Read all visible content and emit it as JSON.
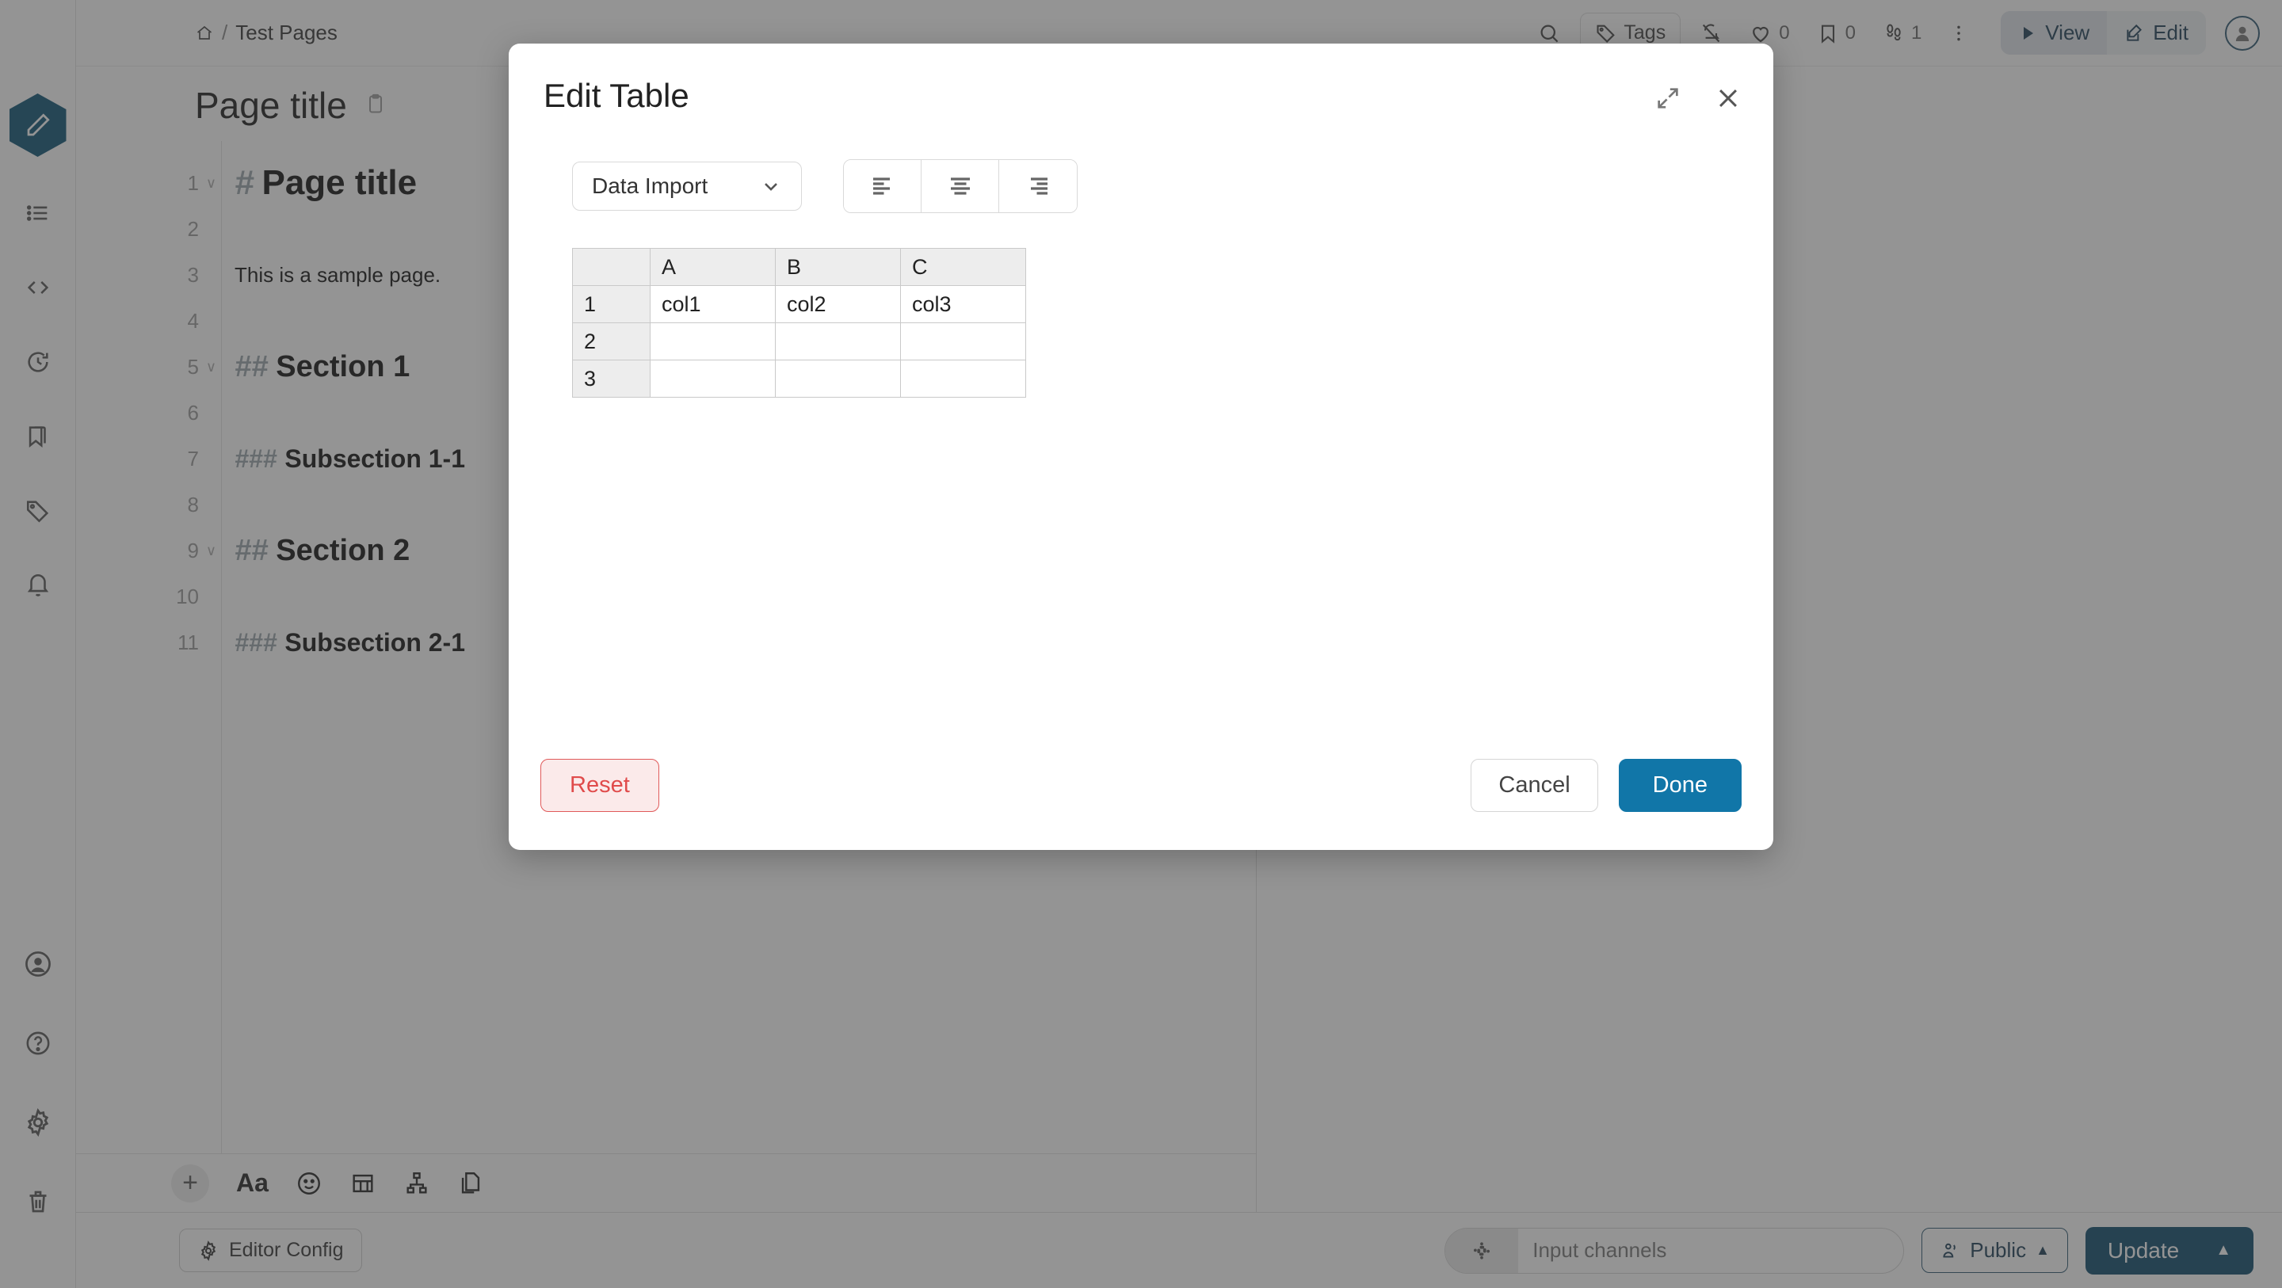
{
  "breadcrumb": {
    "home_icon": "home-icon",
    "separator": "/",
    "path": "Test Pages"
  },
  "header": {
    "search_icon": "search-icon",
    "tags_label": "Tags",
    "tags_icon": "tag-icon",
    "bell_off_icon": "bell-off-icon",
    "heart_icon": "heart-icon",
    "heart_count": "0",
    "bookmark_icon": "bookmark-icon",
    "bookmark_count": "0",
    "footprints_icon": "footprints-icon",
    "footprints_count": "1",
    "kebab_icon": "more-vertical-icon",
    "view_label": "View",
    "view_icon": "play-icon",
    "edit_label": "Edit",
    "edit_icon": "pencil-square-icon",
    "avatar_icon": "user-avatar-icon"
  },
  "sidebar": {
    "top_items": [
      {
        "name": "editor",
        "icon": "pencil-icon",
        "active": true
      },
      {
        "name": "outline",
        "icon": "list-icon",
        "active": false
      },
      {
        "name": "source",
        "icon": "code-icon",
        "active": false
      },
      {
        "name": "history",
        "icon": "history-icon",
        "active": false
      },
      {
        "name": "bookmarks",
        "icon": "bookmarks-icon",
        "active": false
      },
      {
        "name": "tags",
        "icon": "tag-icon",
        "active": false
      },
      {
        "name": "notifications",
        "icon": "bell-icon",
        "active": false
      }
    ],
    "bottom_items": [
      {
        "name": "account",
        "icon": "user-circle-icon"
      },
      {
        "name": "help",
        "icon": "question-circle-icon"
      },
      {
        "name": "settings",
        "icon": "gear-icon"
      },
      {
        "name": "trash",
        "icon": "trash-icon"
      }
    ]
  },
  "page": {
    "title": "Page title",
    "clipboard_icon": "clipboard-icon"
  },
  "editor": {
    "lines": [
      {
        "num": "1",
        "fold": "∨",
        "hash": "#",
        "text": "Page title",
        "style": "h1"
      },
      {
        "num": "2",
        "fold": "",
        "hash": "",
        "text": "",
        "style": "ptext"
      },
      {
        "num": "3",
        "fold": "",
        "hash": "",
        "text": "This is a sample page.",
        "style": "ptext"
      },
      {
        "num": "4",
        "fold": "",
        "hash": "",
        "text": "",
        "style": "ptext"
      },
      {
        "num": "5",
        "fold": "∨",
        "hash": "##",
        "text": "Section 1",
        "style": "h2"
      },
      {
        "num": "6",
        "fold": "",
        "hash": "",
        "text": "",
        "style": "ptext"
      },
      {
        "num": "7",
        "fold": "",
        "hash": "###",
        "text": "Subsection 1-1",
        "style": "h3"
      },
      {
        "num": "8",
        "fold": "",
        "hash": "",
        "text": "",
        "style": "ptext"
      },
      {
        "num": "9",
        "fold": "∨",
        "hash": "##",
        "text": "Section 2",
        "style": "h2"
      },
      {
        "num": "10",
        "fold": "",
        "hash": "",
        "text": "",
        "style": "ptext"
      },
      {
        "num": "11",
        "fold": "",
        "hash": "###",
        "text": "Subsection 2-1",
        "style": "h3"
      }
    ],
    "toolbar": [
      {
        "name": "add",
        "icon": "plus-icon",
        "label": "+"
      },
      {
        "name": "text-style",
        "icon": "text-format-icon",
        "label": "Aa"
      },
      {
        "name": "emoji",
        "icon": "emoji-icon",
        "label": ""
      },
      {
        "name": "table",
        "icon": "table-icon",
        "label": ""
      },
      {
        "name": "diagram",
        "icon": "sitemap-icon",
        "label": ""
      },
      {
        "name": "attachment",
        "icon": "copy-files-icon",
        "label": ""
      }
    ]
  },
  "statusbar": {
    "editor_config_label": "Editor Config",
    "editor_config_icon": "gear-icon",
    "channel_icon": "slack-icon",
    "channel_placeholder": "Input channels",
    "channel_value": "",
    "public_label": "Public",
    "public_icon": "person-speaking-icon",
    "public_caret": "▲",
    "update_label": "Update",
    "update_caret": "▲"
  },
  "modal": {
    "title": "Edit Table",
    "expand_icon": "expand-icon",
    "close_icon": "close-icon",
    "dropdown": {
      "label": "Data Import",
      "caret_icon": "chevron-down-icon"
    },
    "align_buttons": [
      {
        "name": "align-left",
        "icon": "align-left-icon"
      },
      {
        "name": "align-center",
        "icon": "align-center-icon"
      },
      {
        "name": "align-right",
        "icon": "align-right-icon"
      }
    ],
    "table": {
      "corner": "",
      "column_headers": [
        "A",
        "B",
        "C"
      ],
      "row_headers": [
        "1",
        "2",
        "3"
      ],
      "rows": [
        [
          "col1",
          "col2",
          "col3"
        ],
        [
          "",
          "",
          ""
        ],
        [
          "",
          "",
          ""
        ]
      ]
    },
    "reset_label": "Reset",
    "cancel_label": "Cancel",
    "done_label": "Done"
  },
  "colors": {
    "accent_blue": "#1176a8",
    "dark_blue": "#0d4a6b",
    "reset_red": "#e04b4b",
    "header_gray": "#ededed"
  }
}
